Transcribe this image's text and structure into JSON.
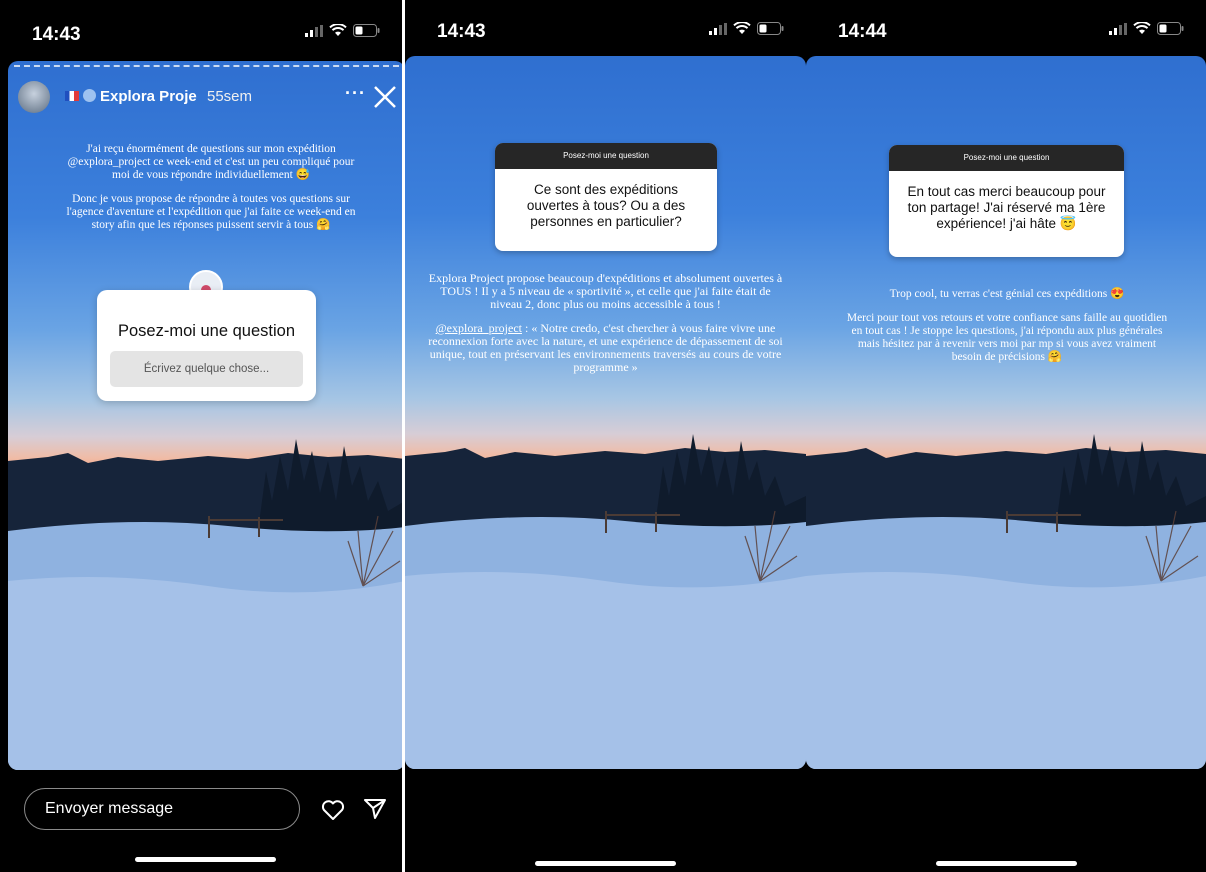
{
  "phones": [
    {
      "time": "14:43",
      "header": {
        "username": "Explora Proje",
        "age": "55sem",
        "more_icon": "more-icon",
        "close_icon": "close-icon"
      },
      "caption": {
        "p1": "J'ai reçu énormément de questions sur mon expédition @explora_project ce week-end et c'est un peu compliqué pour moi de vous répondre individuellement 😅",
        "p2": "Donc je vous propose de répondre à toutes vos questions sur l'agence d'aventure et l'expédition que j'ai faite ce week-end en story afin que les réponses puissent servir à tous 🤗"
      },
      "sticker": {
        "title": "Posez-moi une question",
        "placeholder": "Écrivez quelque chose..."
      },
      "reply": {
        "placeholder": "Envoyer message",
        "heart_icon": "heart-icon",
        "send_icon": "send-icon"
      }
    },
    {
      "time": "14:43",
      "question": {
        "header": "Posez-moi une question",
        "text": "Ce sont des expéditions ouvertes à tous? Ou a des personnes en particulier?"
      },
      "answer": {
        "p1": "Explora Project propose beaucoup d'expéditions et absolument ouvertes à TOUS ! Il y a 5 niveau de « sportivité », et celle que j'ai faite était de niveau 2, donc plus ou moins accessible à tous !",
        "p2_link": "@explora_project",
        "p2": " : « Notre credo, c'est chercher à vous faire vivre une reconnexion forte avec la nature, et une expérience de dépassement de soi unique, tout en préservant les environnements traversés au cours de votre programme »"
      }
    },
    {
      "time": "14:44",
      "question": {
        "header": "Posez-moi une question",
        "text": "En tout cas merci beaucoup pour ton partage! J'ai réservé ma 1ère expérience! j'ai hâte 😇"
      },
      "answer": {
        "p1": "Trop cool, tu verras c'est génial ces expéditions 😍",
        "p2": "Merci pour tout vos retours et votre confiance sans faille au quotidien en tout cas ! Je stoppe les questions, j'ai répondu aux plus générales mais hésitez par à revenir vers moi par mp si vous avez vraiment besoin de précisions 🤗"
      }
    }
  ],
  "colors": {
    "story_bg_top": "#2f6fd0",
    "sunset": "#f3a88c",
    "sticker_header": "#262626"
  }
}
